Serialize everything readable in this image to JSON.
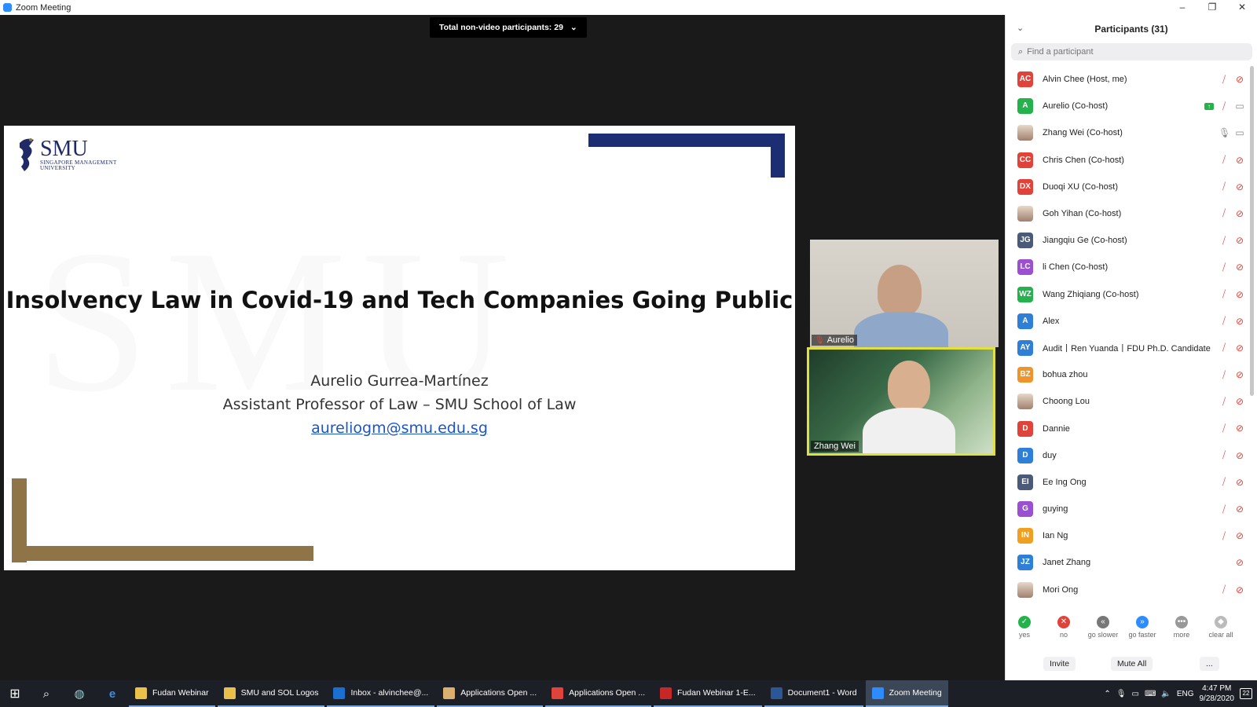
{
  "window": {
    "title": "Zoom Meeting",
    "controls": [
      "–",
      "❐",
      "✕"
    ]
  },
  "stage": {
    "non_video_label": "Total non-video participants: 29",
    "slide": {
      "logo_text": "SMU",
      "logo_sub": "SINGAPORE MANAGEMENT",
      "logo_sub2": "UNIVERSITY",
      "title": "Insolvency Law in Covid-19 and Tech Companies Going Public",
      "presenter": "Aurelio Gurrea-Martínez",
      "role": "Assistant Professor of Law – SMU School of Law",
      "email": "aureliogm@smu.edu.sg",
      "colors": {
        "navy": "#1c2d73",
        "gold": "#8f7448"
      }
    },
    "videos": [
      {
        "name": "Aurelio",
        "muted": true
      },
      {
        "name": "Zhang Wei",
        "muted": false,
        "active_speaker": true
      }
    ]
  },
  "participants": {
    "title": "Participants (31)",
    "search_placeholder": "Find a participant",
    "list": [
      {
        "initials": "AC",
        "name": "Alvin Chee (Host, me)",
        "color": "#e0433a",
        "mic": "muted",
        "video": "off"
      },
      {
        "initials": "A",
        "name": "Aurelio (Co-host)",
        "color": "#23b24b",
        "mic": "muted",
        "video": "on",
        "sharing": true
      },
      {
        "initials": "",
        "name": "Zhang Wei (Co-host)",
        "photo": true,
        "mic": "on",
        "video": "on"
      },
      {
        "initials": "CC",
        "name": "Chris Chen (Co-host)",
        "color": "#e0433a",
        "mic": "muted",
        "video": "off"
      },
      {
        "initials": "DX",
        "name": "Duoqi XU (Co-host)",
        "color": "#e0433a",
        "mic": "muted",
        "video": "off"
      },
      {
        "initials": "",
        "name": "Goh Yihan (Co-host)",
        "photo": true,
        "mic": "muted",
        "video": "off"
      },
      {
        "initials": "JG",
        "name": "Jiangqiu Ge (Co-host)",
        "color": "#4a5a78",
        "mic": "muted",
        "video": "off"
      },
      {
        "initials": "LC",
        "name": "li Chen (Co-host)",
        "color": "#9b4fd1",
        "mic": "muted",
        "video": "off"
      },
      {
        "initials": "WZ",
        "name": "Wang Zhiqiang (Co-host)",
        "color": "#23b24b",
        "mic": "muted",
        "video": "off"
      },
      {
        "initials": "A",
        "name": "Alex",
        "color": "#2d7fd8",
        "mic": "muted",
        "video": "off"
      },
      {
        "initials": "AY",
        "name": "Audit丨Ren Yuanda丨FDU Ph.D. Candidate",
        "color": "#2d7fd8",
        "mic": "muted",
        "video": "off"
      },
      {
        "initials": "BZ",
        "name": "bohua zhou",
        "color": "#f0932b",
        "mic": "muted",
        "video": "off"
      },
      {
        "initials": "",
        "name": "Choong Lou",
        "photo": true,
        "mic": "muted",
        "video": "off"
      },
      {
        "initials": "D",
        "name": "Dannie",
        "color": "#e0433a",
        "mic": "muted",
        "video": "off"
      },
      {
        "initials": "D",
        "name": "duy",
        "color": "#2d7fd8",
        "mic": "muted",
        "video": "off"
      },
      {
        "initials": "EI",
        "name": "Ee Ing Ong",
        "color": "#4a5a78",
        "mic": "muted",
        "video": "off"
      },
      {
        "initials": "G",
        "name": "guying",
        "color": "#9b4fd1",
        "mic": "muted",
        "video": "off"
      },
      {
        "initials": "IN",
        "name": "Ian Ng",
        "color": "#f0a020",
        "mic": "muted",
        "video": "off"
      },
      {
        "initials": "JZ",
        "name": "Janet Zhang",
        "color": "#2d7fd8",
        "mic": "none",
        "video": "off"
      },
      {
        "initials": "",
        "name": "Mori Ong",
        "photo": true,
        "mic": "muted",
        "video": "off"
      }
    ],
    "reactions": [
      {
        "label": "yes",
        "glyph": "✓",
        "color": "#23b24b"
      },
      {
        "label": "no",
        "glyph": "✕",
        "color": "#e0433a"
      },
      {
        "label": "go slower",
        "glyph": "«",
        "color": "#777"
      },
      {
        "label": "go faster",
        "glyph": "»",
        "color": "#2d8cff"
      },
      {
        "label": "more",
        "glyph": "•••",
        "color": "#999"
      },
      {
        "label": "clear all",
        "glyph": "◆",
        "color": "#bbb"
      }
    ],
    "footer": {
      "invite": "Invite",
      "mute_all": "Mute All",
      "more": "..."
    }
  },
  "taskbar": {
    "items": [
      {
        "label": "Fudan Webinar",
        "icon": "folder-icon",
        "color": "#e8c04a"
      },
      {
        "label": "SMU and SOL Logos",
        "icon": "folder-icon",
        "color": "#e8c04a"
      },
      {
        "label": "Inbox - alvinchee@...",
        "icon": "outlook-icon",
        "color": "#1a6fd1"
      },
      {
        "label": "Applications Open ...",
        "icon": "mail-icon",
        "color": "#d9b070"
      },
      {
        "label": "Applications Open ...",
        "icon": "chrome-icon",
        "color": "#e0433a"
      },
      {
        "label": "Fudan Webinar 1-E...",
        "icon": "pdf-icon",
        "color": "#c62828"
      },
      {
        "label": "Document1 - Word",
        "icon": "word-icon",
        "color": "#2b5797"
      },
      {
        "label": "Zoom Meeting",
        "icon": "zoom-icon",
        "color": "#2d8cff",
        "active": true
      }
    ],
    "tray": {
      "lang": "ENG",
      "time": "4:47 PM",
      "date": "9/28/2020",
      "notif_count": "22"
    }
  }
}
